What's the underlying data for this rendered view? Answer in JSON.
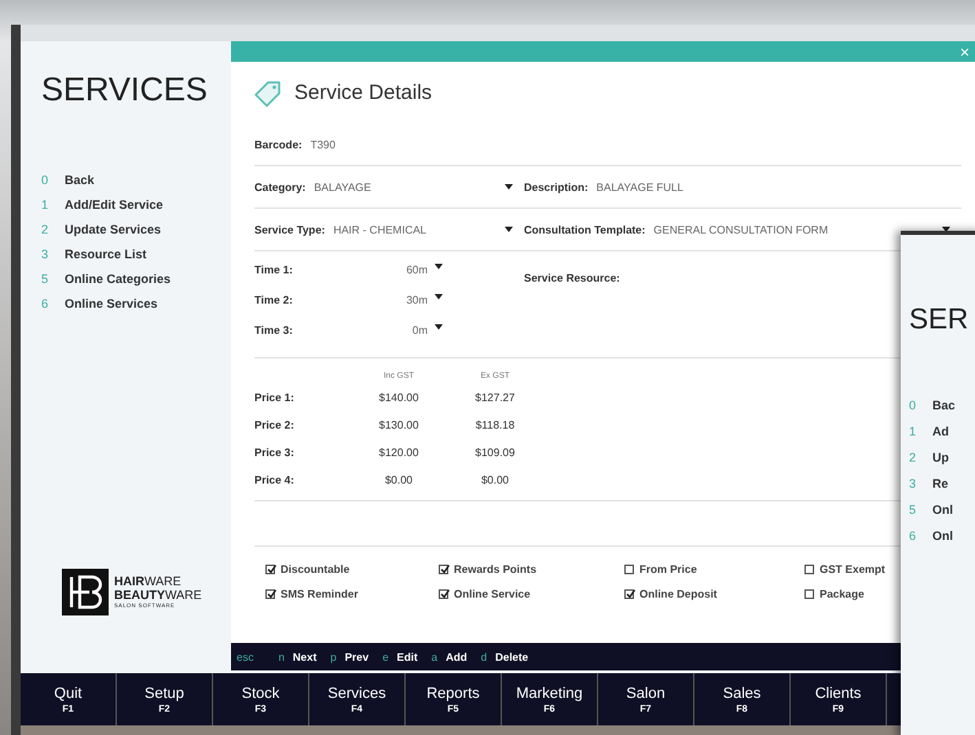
{
  "sidebar": {
    "title": "SERVICES",
    "items": [
      {
        "key": "0",
        "label": "Back"
      },
      {
        "key": "1",
        "label": "Add/Edit Service"
      },
      {
        "key": "2",
        "label": "Update Services"
      },
      {
        "key": "3",
        "label": "Resource List"
      },
      {
        "key": "5",
        "label": "Online Categories"
      },
      {
        "key": "6",
        "label": "Online Services"
      }
    ],
    "logo": {
      "line1": "**HAIR**WARE",
      "line2": "**BEAUTY**WARE",
      "tagline": "SALON SOFTWARE"
    }
  },
  "dialog": {
    "close": "×",
    "title": "Service Details",
    "barcode": {
      "label": "Barcode:",
      "value": "T390"
    },
    "category": {
      "label": "Category:",
      "value": "BALAYAGE"
    },
    "description": {
      "label": "Description:",
      "value": "BALAYAGE FULL"
    },
    "service_type": {
      "label": "Service Type:",
      "value": "HAIR - CHEMICAL"
    },
    "consultation_template": {
      "label": "Consultation Template:",
      "value": "GENERAL CONSULTATION FORM"
    },
    "times": [
      {
        "label": "Time 1:",
        "value": "60m"
      },
      {
        "label": "Time 2:",
        "value": "30m"
      },
      {
        "label": "Time 3:",
        "value": "0m"
      }
    ],
    "service_resource": {
      "label": "Service Resource:"
    },
    "price_headers": [
      "Inc GST",
      "Ex GST"
    ],
    "prices": [
      {
        "label": "Price 1:",
        "inc": "$140.00",
        "ex": "$127.27"
      },
      {
        "label": "Price 2:",
        "inc": "$130.00",
        "ex": "$118.18"
      },
      {
        "label": "Price 3:",
        "inc": "$120.00",
        "ex": "$109.09"
      },
      {
        "label": "Price 4:",
        "inc": "$0.00",
        "ex": "$0.00"
      }
    ],
    "checkboxes": [
      {
        "label": "Discountable",
        "checked": true
      },
      {
        "label": "Rewards Points",
        "checked": true
      },
      {
        "label": "From Price",
        "checked": false
      },
      {
        "label": "GST Exempt",
        "checked": false
      },
      {
        "label": "SMS Reminder",
        "checked": true
      },
      {
        "label": "Online Service",
        "checked": true
      },
      {
        "label": "Online Deposit",
        "checked": true
      },
      {
        "label": "Package",
        "checked": false
      }
    ],
    "shortcuts": [
      {
        "key": "esc"
      },
      {
        "key": "n",
        "label": "Next"
      },
      {
        "key": "p",
        "label": "Prev"
      },
      {
        "key": "e",
        "label": "Edit"
      },
      {
        "key": "a",
        "label": "Add"
      },
      {
        "key": "d",
        "label": "Delete"
      }
    ]
  },
  "function_keys": [
    {
      "label": "Quit",
      "key": "F1"
    },
    {
      "label": "Setup",
      "key": "F2"
    },
    {
      "label": "Stock",
      "key": "F3"
    },
    {
      "label": "Services",
      "key": "F4"
    },
    {
      "label": "Reports",
      "key": "F5"
    },
    {
      "label": "Marketing",
      "key": "F6"
    },
    {
      "label": "Salon",
      "key": "F7"
    },
    {
      "label": "Sales",
      "key": "F8"
    },
    {
      "label": "Clients",
      "key": "F9"
    }
  ],
  "second_window": {
    "title": "SER",
    "items": [
      {
        "key": "0",
        "label": "Bac"
      },
      {
        "key": "1",
        "label": "Ad"
      },
      {
        "key": "2",
        "label": "Up"
      },
      {
        "key": "3",
        "label": "Re"
      },
      {
        "key": "5",
        "label": "Onl"
      },
      {
        "key": "6",
        "label": "Onl"
      }
    ]
  }
}
